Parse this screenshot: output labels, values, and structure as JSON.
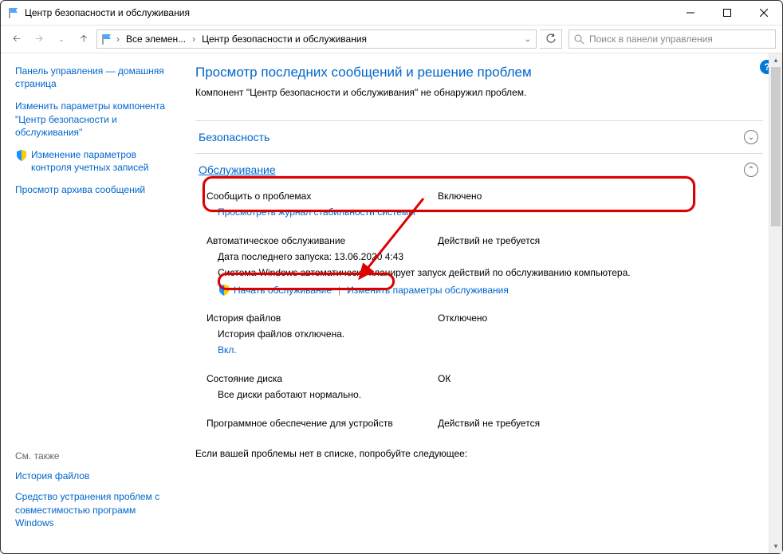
{
  "title": "Центр безопасности и обслуживания",
  "breadcrumb": {
    "b1": "Все элемен...",
    "b2": "Центр безопасности и обслуживания"
  },
  "search": {
    "placeholder": "Поиск в панели управления"
  },
  "sidebar": {
    "l1": "Панель управления — домашняя страница",
    "l2": "Изменить параметры компонента \"Центр безопасности и обслуживания\"",
    "l3": "Изменение параметров контроля учетных записей",
    "l4": "Просмотр архива сообщений",
    "see_also": "См. также",
    "s1": "История файлов",
    "s2": "Средство устранения проблем с совместимостью программ Windows"
  },
  "main": {
    "heading": "Просмотр последних сообщений и решение проблем",
    "subtext": "Компонент \"Центр безопасности и обслуживания\" не обнаружил проблем.",
    "sec_security": "Безопасность",
    "sec_maint": "Обслуживание",
    "report": {
      "label": "Сообщить о проблемах",
      "status": "Включено",
      "link": "Просмотреть журнал стабильности системы"
    },
    "automaint": {
      "label": "Автоматическое обслуживание",
      "status": "Действий не требуется",
      "lastrun": "Дата последнего запуска: 13.06.2020 4:43",
      "desc": "Система Windows автоматически планирует запуск действий по обслуживанию компьютера.",
      "start": "Начать обслуживание",
      "change": "Изменить параметры обслуживания"
    },
    "filehist": {
      "label": "История файлов",
      "status": "Отключено",
      "desc": "История файлов отключена.",
      "link": "Вкл."
    },
    "disk": {
      "label": "Состояние диска",
      "status": "ОК",
      "desc": "Все диски работают нормально."
    },
    "drivers": {
      "label": "Программное обеспечение для устройств",
      "status": "Действий не требуется"
    },
    "footer": "Если вашей проблемы нет в списке, попробуйте следующее:"
  }
}
